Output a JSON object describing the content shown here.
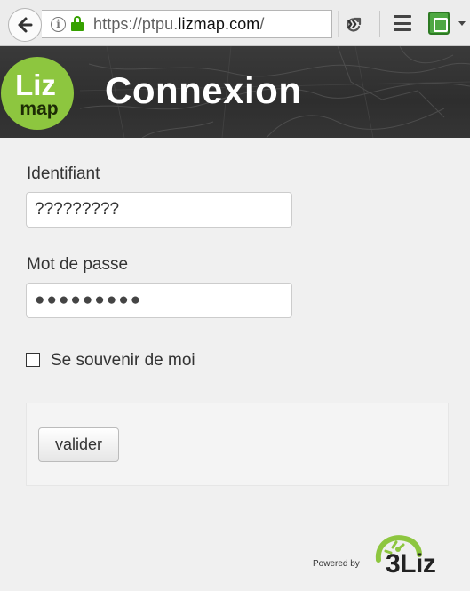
{
  "browser": {
    "url_prefix": "https://ptpu.",
    "url_host": "lizmap.com",
    "url_suffix": "/"
  },
  "header": {
    "logo_top": "Liz",
    "logo_bottom": "map",
    "title": "Connexion"
  },
  "form": {
    "username_label": "Identifiant",
    "username_value": "?????????",
    "password_label": "Mot de passe",
    "password_value": "●●●●●●●●●",
    "remember_label": "Se souvenir de moi",
    "remember_checked": false,
    "submit_label": "valider"
  },
  "footer": {
    "powered_by": "Powered by",
    "brand": "3Liz"
  },
  "colors": {
    "logo_green": "#8dc63f",
    "lock_green": "#36a100",
    "header_bg": "#333333"
  }
}
